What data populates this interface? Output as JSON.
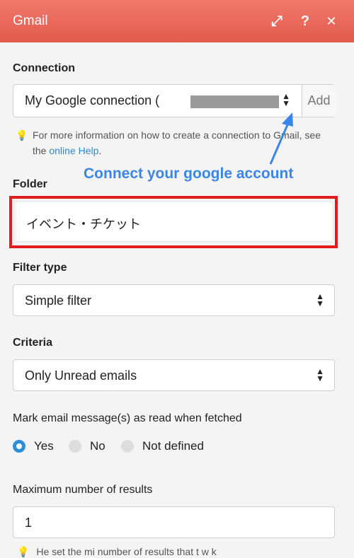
{
  "header": {
    "title": "Gmail",
    "expand_icon": "⤢",
    "help_icon": "?",
    "close_icon": "✕"
  },
  "connection": {
    "label": "Connection",
    "value": "My Google connection (",
    "add_label": "Add",
    "help_text_1": "For more information on how to create a connection to Gmail, see the ",
    "help_link": "online Help",
    "help_text_2": "."
  },
  "annotation": {
    "text": "Connect your google account",
    "color": "#3a86e6"
  },
  "folder": {
    "label": "Folder",
    "value": "イベント・チケット"
  },
  "filter_type": {
    "label": "Filter type",
    "value": "Simple filter"
  },
  "criteria": {
    "label": "Criteria",
    "value": "Only Unread emails"
  },
  "mark_read": {
    "label": "Mark email message(s) as read when fetched",
    "options": [
      {
        "label": "Yes",
        "selected": true
      },
      {
        "label": "No",
        "selected": false
      },
      {
        "label": "Not defined",
        "selected": false
      }
    ]
  },
  "max_results": {
    "label": "Maximum number of results",
    "value": "1",
    "help_text": "He   set the   mi    number of results that   t   w    k"
  },
  "colors": {
    "header": "#e8604f",
    "accent": "#2d8fdb",
    "highlight_border": "#e21b1b"
  }
}
